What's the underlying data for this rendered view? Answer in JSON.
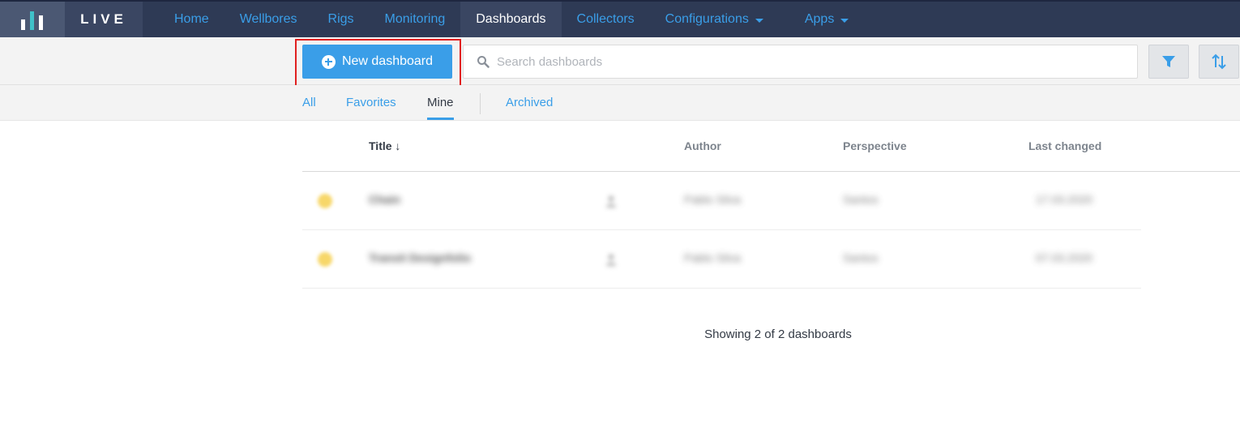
{
  "app": {
    "logo_text": "LIVE"
  },
  "nav": {
    "items": [
      {
        "label": "Home"
      },
      {
        "label": "Wellbores"
      },
      {
        "label": "Rigs"
      },
      {
        "label": "Monitoring"
      },
      {
        "label": "Dashboards"
      },
      {
        "label": "Collectors"
      },
      {
        "label": "Configurations"
      },
      {
        "label": "Apps"
      }
    ],
    "active": "Dashboards"
  },
  "toolbar": {
    "new_button_label": "New dashboard",
    "search_placeholder": "Search dashboards",
    "search_value": ""
  },
  "tabs": [
    {
      "label": "All"
    },
    {
      "label": "Favorites"
    },
    {
      "label": "Mine"
    },
    {
      "label": "Archived"
    }
  ],
  "active_tab": "Mine",
  "table": {
    "columns": {
      "title": "Title ↓",
      "author": "Author",
      "perspective": "Perspective",
      "last_changed": "Last changed"
    },
    "rows": [
      {
        "title": "Chain",
        "author": "Pablo Silva",
        "perspective": "Santos",
        "last_changed": "17.03.2020"
      },
      {
        "title": "Transit Designfolio",
        "author": "Pablo Silva",
        "perspective": "Santos",
        "last_changed": "07.03.2020"
      }
    ]
  },
  "footer": {
    "status_text": "Showing 2 of 2 dashboards"
  },
  "colors": {
    "accent": "#3a9ee8",
    "nav_bg": "#2e3a55",
    "highlight": "#e02020",
    "star": "#f7d76a"
  }
}
